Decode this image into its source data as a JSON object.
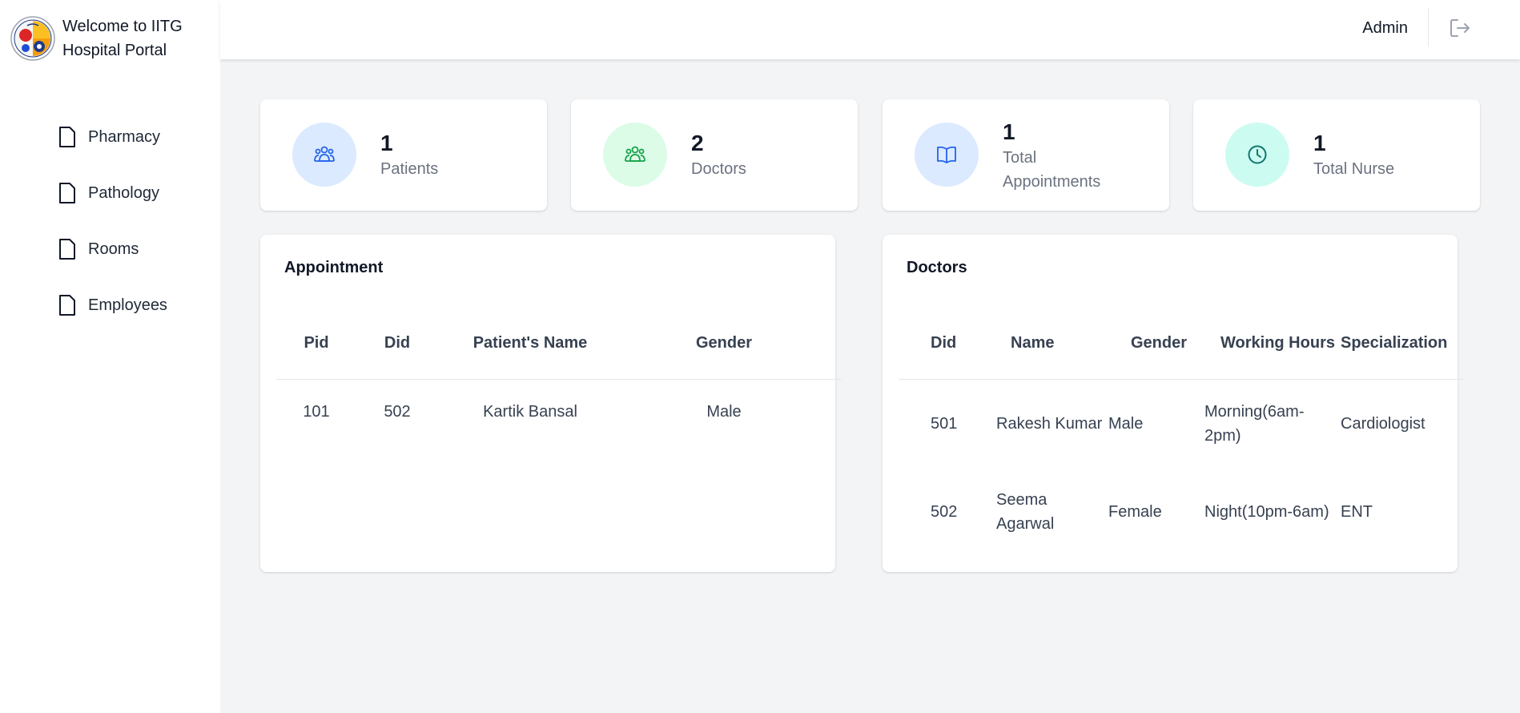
{
  "brand": {
    "line1": "Welcome to IITG",
    "line2": "Hospital Portal"
  },
  "sidebar": {
    "items": [
      {
        "label": "Pharmacy",
        "icon": "file-icon"
      },
      {
        "label": "Pathology",
        "icon": "file-icon"
      },
      {
        "label": "Rooms",
        "icon": "file-icon"
      },
      {
        "label": "Employees",
        "icon": "file-icon"
      }
    ]
  },
  "header": {
    "user": "Admin",
    "logout_icon": "logout-icon"
  },
  "stats": [
    {
      "value": "1",
      "label": "Patients",
      "icon": "users-icon",
      "circle_color": "#dbeafe",
      "icon_color": "#2563eb"
    },
    {
      "value": "2",
      "label": "Doctors",
      "icon": "users-icon",
      "circle_color": "#dcfce7",
      "icon_color": "#16a34a"
    },
    {
      "value": "1",
      "label_line1": "Total",
      "label_line2": "Appointments",
      "icon": "book-icon",
      "circle_color": "#dbeafe",
      "icon_color": "#2563eb"
    },
    {
      "value": "1",
      "label": "Total Nurse",
      "icon": "clock-icon",
      "circle_color": "#ccfbf1",
      "icon_color": "#0f766e"
    }
  ],
  "appointments": {
    "title": "Appointment",
    "columns": [
      "Pid",
      "Did",
      "Patient's Name",
      "Gender"
    ],
    "rows": [
      [
        "101",
        "502",
        "Kartik Bansal",
        "Male"
      ]
    ]
  },
  "doctors": {
    "title": "Doctors",
    "columns": [
      "Did",
      "Name",
      "Gender",
      "Working Hours",
      "Specialization"
    ],
    "rows": [
      {
        "did": "501",
        "name_line1": "Rakesh Kumar",
        "name_line2": "",
        "gender": "Male",
        "hours_line1": "Morning(6am-",
        "hours_line2": "2pm)",
        "spec": "Cardiologist"
      },
      {
        "did": "502",
        "name_line1": "Seema",
        "name_line2": "Agarwal",
        "gender": "Female",
        "hours_line1": "Night(10pm-6am)",
        "hours_line2": "",
        "spec": "ENT"
      }
    ]
  }
}
